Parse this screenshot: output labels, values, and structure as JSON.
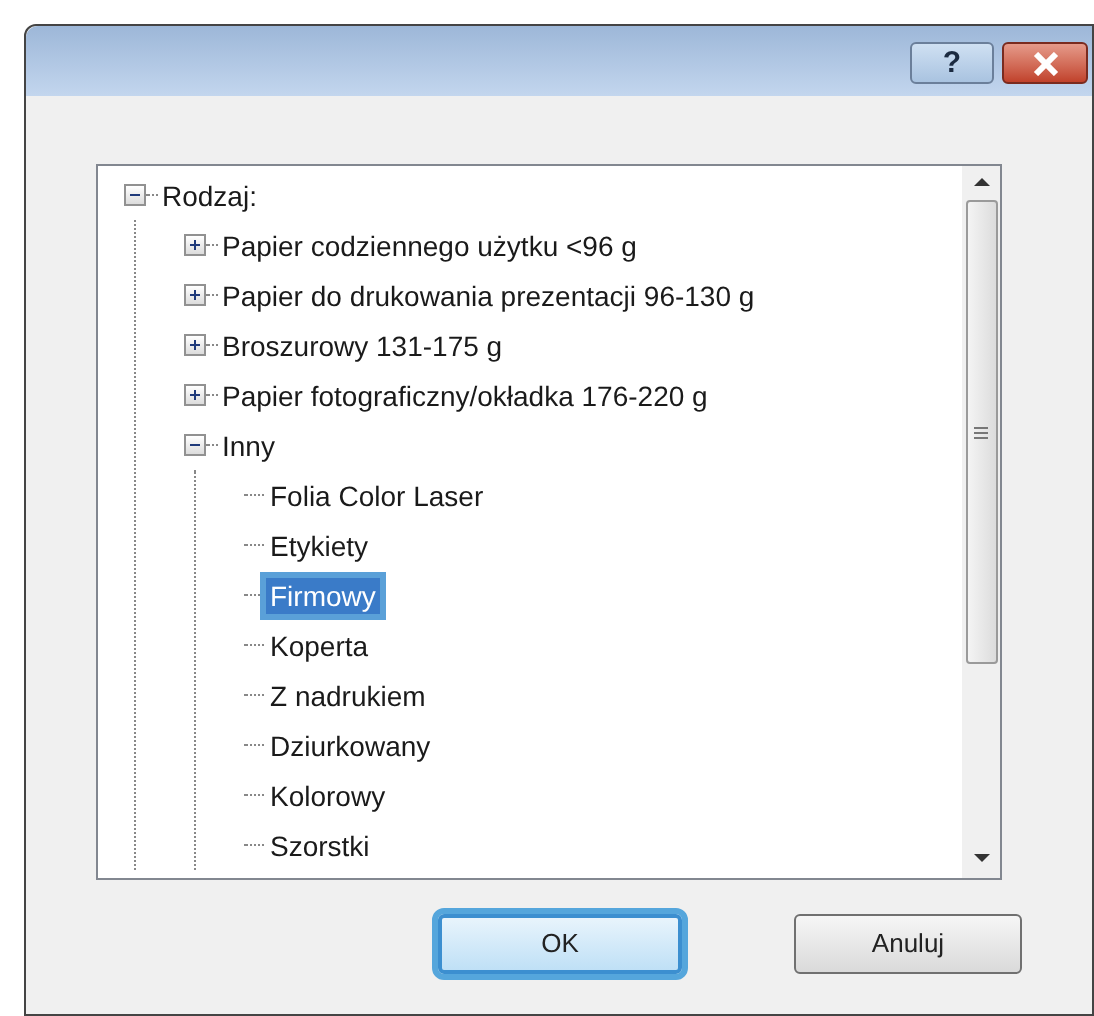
{
  "title_bar": {
    "help_button": "?"
  },
  "tree": [
    {
      "label": "Rodzaj:",
      "expanded": true,
      "selected": false,
      "children": [
        {
          "label": "Papier codziennego użytku <96 g",
          "expanded": false,
          "selected": false
        },
        {
          "label": "Papier do drukowania prezentacji 96-130 g",
          "expanded": false,
          "selected": false
        },
        {
          "label": "Broszurowy 131-175 g",
          "expanded": false,
          "selected": false
        },
        {
          "label": "Papier fotograficzny/okładka 176-220 g",
          "expanded": false,
          "selected": false
        },
        {
          "label": "Inny",
          "expanded": true,
          "selected": false,
          "children": [
            {
              "label": "Folia Color Laser",
              "selected": false
            },
            {
              "label": "Etykiety",
              "selected": false
            },
            {
              "label": "Firmowy",
              "selected": true
            },
            {
              "label": "Koperta",
              "selected": false
            },
            {
              "label": "Z nadrukiem",
              "selected": false
            },
            {
              "label": "Dziurkowany",
              "selected": false
            },
            {
              "label": "Kolorowy",
              "selected": false
            },
            {
              "label": "Szorstki",
              "selected": false
            }
          ]
        }
      ]
    }
  ],
  "buttons": [
    {
      "label": "OK",
      "focused": true
    },
    {
      "label": "Anuluj",
      "focused": false
    }
  ]
}
